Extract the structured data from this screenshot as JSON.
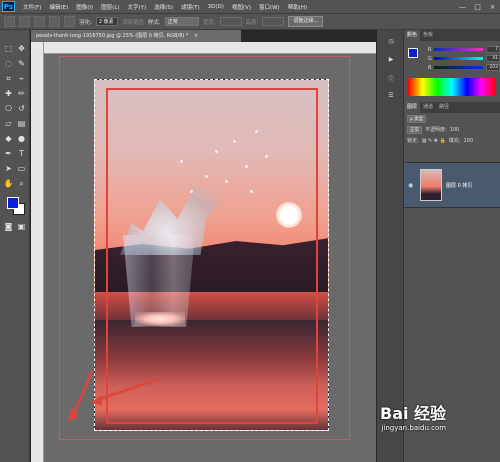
{
  "menubar": {
    "logo": "Ps",
    "items": [
      "文件(F)",
      "编辑(E)",
      "图像(I)",
      "图层(L)",
      "文字(Y)",
      "选择(S)",
      "滤镜(T)",
      "3D(D)",
      "视图(V)",
      "窗口(W)",
      "帮助(H)"
    ],
    "controls": [
      "—",
      "□",
      "×"
    ]
  },
  "options": {
    "feather_label": "羽化:",
    "feather_value": "2 像素",
    "antialias_label": "消除锯齿",
    "style_label": "样式:",
    "style_value": "正常",
    "width_label": "宽度:",
    "height_label": "高度:",
    "refine_button": "调整边缘..."
  },
  "document": {
    "tab_title": "pexels-thanh-long-1916750.jpg @ 25% (图层 0 拷贝, RGB/8) *",
    "tab_close": "×"
  },
  "panels": {
    "color_tabs": [
      "颜色",
      "色板"
    ],
    "color_rows": [
      {
        "label": "R",
        "value": "7"
      },
      {
        "label": "G",
        "value": "41"
      },
      {
        "label": "B",
        "value": "203"
      }
    ],
    "layer_tabs": [
      "图层",
      "通道",
      "路径"
    ],
    "kind_label": "ρ 类型",
    "blend_mode": "正常",
    "opacity_label": "不透明度:",
    "opacity_value": "100",
    "lock_label": "锁定:",
    "fill_label": "填充:",
    "fill_value": "100",
    "layer_name": "图层 0 拷贝"
  },
  "watermark": {
    "logo": "Bai 经验",
    "url": "jingyan.baidu.com"
  },
  "colors": {
    "foreground": "#0a1fd4",
    "background": "#ffffff",
    "annotation_red": "#e0433a"
  }
}
